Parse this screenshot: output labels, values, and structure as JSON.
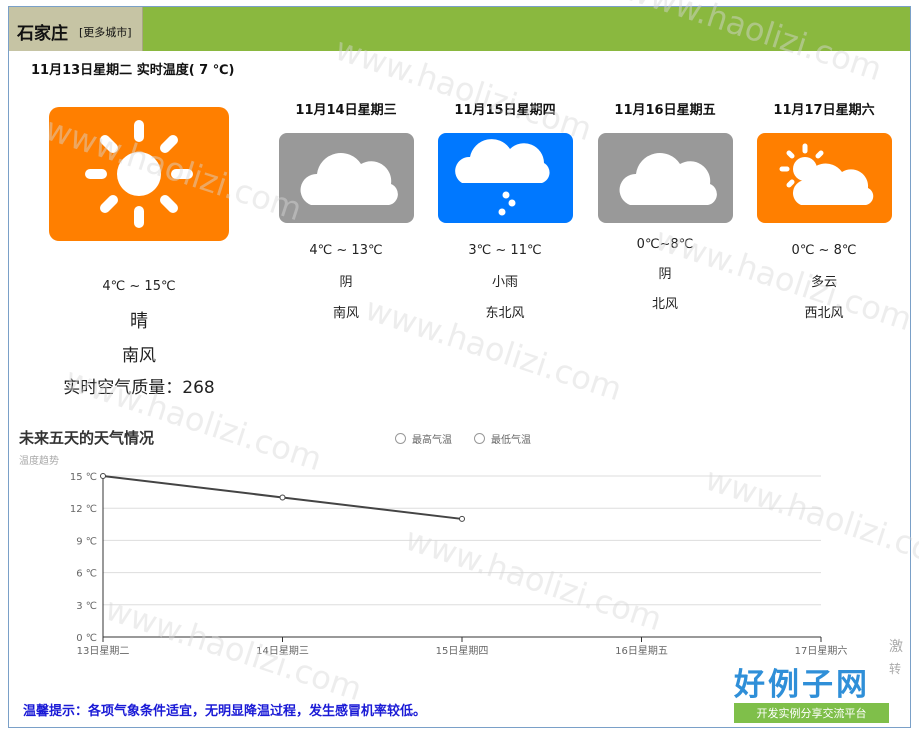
{
  "city": "石家庄",
  "more_cities": "[更多城市]",
  "today": {
    "header": "11月13日星期二  实时温度( 7 ℃)",
    "temp_range": "4℃ ~ 15℃",
    "condition": "晴",
    "wind": "南风",
    "air_quality": "实时空气质量：268",
    "icon": "sunny-icon"
  },
  "forecast": [
    {
      "date": "11月14日星期三",
      "temp": "4℃ ~ 13℃",
      "condition": "阴",
      "wind": "南风",
      "icon": "cloudy-icon",
      "color": "#999999"
    },
    {
      "date": "11月15日星期四",
      "temp": "3℃ ~ 11℃",
      "condition": "小雨",
      "wind": "东北风",
      "icon": "light-rain-icon",
      "color": "#0078ff"
    },
    {
      "date": "11月16日星期五",
      "temp": "0℃~8℃",
      "condition": "阴",
      "wind": "北风",
      "icon": "cloudy-icon",
      "color": "#999999"
    },
    {
      "date": "11月17日星期六",
      "temp": "0℃ ~ 8℃",
      "condition": "多云",
      "wind": "西北风",
      "icon": "partly-cloudy-icon",
      "color": "#ff7f00"
    }
  ],
  "chart_data": {
    "type": "line",
    "title": "未来五天的天气情况",
    "subtitle": "温度趋势",
    "categories": [
      "13日星期二",
      "14日星期三",
      "15日星期四",
      "16日星期五",
      "17日星期六"
    ],
    "series": [
      {
        "name": "最高气温",
        "values": [
          15,
          13,
          11,
          null,
          null
        ]
      },
      {
        "name": "最低气温",
        "values": [
          null,
          null,
          null,
          null,
          null
        ]
      }
    ],
    "y_ticks": [
      "0 ℃",
      "3 ℃",
      "6 ℃",
      "9 ℃",
      "12 ℃",
      "15 ℃"
    ],
    "ylim": [
      0,
      15
    ],
    "grid": true,
    "legend_position": "top-center"
  },
  "tip": "温馨提示：各项气象条件适宜，无明显降温过程，发生感冒机率较低。",
  "logo": {
    "main": "好例子网",
    "sub": "开发实例分享交流平台"
  },
  "watermark": "www.haolizi.com",
  "cut_text": [
    "激",
    "转"
  ]
}
